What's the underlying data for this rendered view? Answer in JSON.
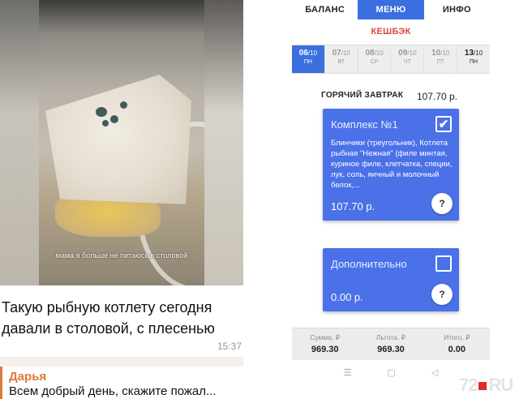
{
  "chat": {
    "photo_caption": "мама я больше не питаюсь в столовой",
    "message": "Такую рыбную котлету сегодня давали в столовой, с плесенью",
    "time": "15:37",
    "reply": {
      "author": "Дарья",
      "text": "Всем добрый день, скажите пожал..."
    }
  },
  "app": {
    "tabs": [
      {
        "label": "БАЛАНС",
        "active": false
      },
      {
        "label": "МЕНЮ",
        "active": true
      },
      {
        "label": "ИНФО",
        "active": false
      }
    ],
    "cashback_label": "КЕШБЭК",
    "days": [
      {
        "num": "06",
        "month": "/10",
        "weekday": "ПН",
        "state": "active"
      },
      {
        "num": "07",
        "month": "/10",
        "weekday": "ВТ",
        "state": "normal"
      },
      {
        "num": "08",
        "month": "/10",
        "weekday": "СР",
        "state": "normal"
      },
      {
        "num": "09",
        "month": "/10",
        "weekday": "ЧТ",
        "state": "normal"
      },
      {
        "num": "10",
        "month": "/10",
        "weekday": "ПТ",
        "state": "normal"
      },
      {
        "num": "13",
        "month": "/10",
        "weekday": "ПН",
        "state": "today"
      }
    ],
    "meal": {
      "title": "ГОРЯЧИЙ ЗАВТРАК",
      "price": "107.70 р."
    },
    "cards": [
      {
        "title": "Комплекс №1",
        "checked": true,
        "description": "Блинчики (треугольник), Котлета рыбная \"Нежная\" (филе минтая, куриное филе, клетчатка, специи, лук, соль, яичный и молочный белок,...",
        "price": "107.70 р.",
        "help": "?"
      },
      {
        "title": "Дополнительно",
        "checked": false,
        "description": "",
        "price": "0.00 р.",
        "help": "?"
      }
    ],
    "totals": [
      {
        "label": "Сумма, ₽",
        "value": "969.30"
      },
      {
        "label": "Льгота, ₽",
        "value": "969.30"
      },
      {
        "label": "Итого, ₽",
        "value": "0.00"
      }
    ],
    "system_nav": {
      "menu": "☰",
      "home": "▢",
      "back": "◁"
    }
  },
  "watermark": {
    "left": "72",
    "right": "RU"
  },
  "colors": {
    "accent": "#3b6fe0",
    "card": "#4b71e8",
    "cashback": "#d9463c",
    "reply_accent": "#e07b3a"
  }
}
